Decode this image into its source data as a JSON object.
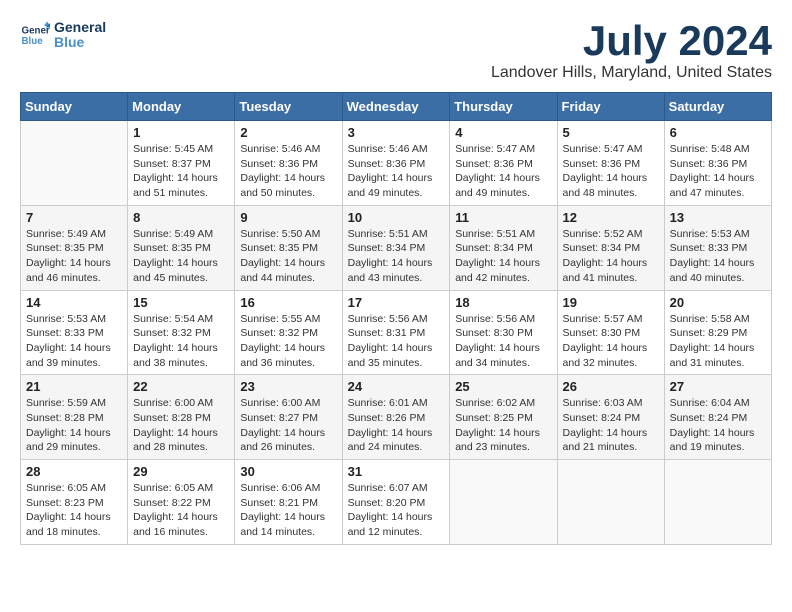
{
  "header": {
    "logo_line1": "General",
    "logo_line2": "Blue",
    "month": "July 2024",
    "location": "Landover Hills, Maryland, United States"
  },
  "weekdays": [
    "Sunday",
    "Monday",
    "Tuesday",
    "Wednesday",
    "Thursday",
    "Friday",
    "Saturday"
  ],
  "weeks": [
    [
      {
        "day": "",
        "info": ""
      },
      {
        "day": "1",
        "info": "Sunrise: 5:45 AM\nSunset: 8:37 PM\nDaylight: 14 hours\nand 51 minutes."
      },
      {
        "day": "2",
        "info": "Sunrise: 5:46 AM\nSunset: 8:36 PM\nDaylight: 14 hours\nand 50 minutes."
      },
      {
        "day": "3",
        "info": "Sunrise: 5:46 AM\nSunset: 8:36 PM\nDaylight: 14 hours\nand 49 minutes."
      },
      {
        "day": "4",
        "info": "Sunrise: 5:47 AM\nSunset: 8:36 PM\nDaylight: 14 hours\nand 49 minutes."
      },
      {
        "day": "5",
        "info": "Sunrise: 5:47 AM\nSunset: 8:36 PM\nDaylight: 14 hours\nand 48 minutes."
      },
      {
        "day": "6",
        "info": "Sunrise: 5:48 AM\nSunset: 8:36 PM\nDaylight: 14 hours\nand 47 minutes."
      }
    ],
    [
      {
        "day": "7",
        "info": "Sunrise: 5:49 AM\nSunset: 8:35 PM\nDaylight: 14 hours\nand 46 minutes."
      },
      {
        "day": "8",
        "info": "Sunrise: 5:49 AM\nSunset: 8:35 PM\nDaylight: 14 hours\nand 45 minutes."
      },
      {
        "day": "9",
        "info": "Sunrise: 5:50 AM\nSunset: 8:35 PM\nDaylight: 14 hours\nand 44 minutes."
      },
      {
        "day": "10",
        "info": "Sunrise: 5:51 AM\nSunset: 8:34 PM\nDaylight: 14 hours\nand 43 minutes."
      },
      {
        "day": "11",
        "info": "Sunrise: 5:51 AM\nSunset: 8:34 PM\nDaylight: 14 hours\nand 42 minutes."
      },
      {
        "day": "12",
        "info": "Sunrise: 5:52 AM\nSunset: 8:34 PM\nDaylight: 14 hours\nand 41 minutes."
      },
      {
        "day": "13",
        "info": "Sunrise: 5:53 AM\nSunset: 8:33 PM\nDaylight: 14 hours\nand 40 minutes."
      }
    ],
    [
      {
        "day": "14",
        "info": "Sunrise: 5:53 AM\nSunset: 8:33 PM\nDaylight: 14 hours\nand 39 minutes."
      },
      {
        "day": "15",
        "info": "Sunrise: 5:54 AM\nSunset: 8:32 PM\nDaylight: 14 hours\nand 38 minutes."
      },
      {
        "day": "16",
        "info": "Sunrise: 5:55 AM\nSunset: 8:32 PM\nDaylight: 14 hours\nand 36 minutes."
      },
      {
        "day": "17",
        "info": "Sunrise: 5:56 AM\nSunset: 8:31 PM\nDaylight: 14 hours\nand 35 minutes."
      },
      {
        "day": "18",
        "info": "Sunrise: 5:56 AM\nSunset: 8:30 PM\nDaylight: 14 hours\nand 34 minutes."
      },
      {
        "day": "19",
        "info": "Sunrise: 5:57 AM\nSunset: 8:30 PM\nDaylight: 14 hours\nand 32 minutes."
      },
      {
        "day": "20",
        "info": "Sunrise: 5:58 AM\nSunset: 8:29 PM\nDaylight: 14 hours\nand 31 minutes."
      }
    ],
    [
      {
        "day": "21",
        "info": "Sunrise: 5:59 AM\nSunset: 8:28 PM\nDaylight: 14 hours\nand 29 minutes."
      },
      {
        "day": "22",
        "info": "Sunrise: 6:00 AM\nSunset: 8:28 PM\nDaylight: 14 hours\nand 28 minutes."
      },
      {
        "day": "23",
        "info": "Sunrise: 6:00 AM\nSunset: 8:27 PM\nDaylight: 14 hours\nand 26 minutes."
      },
      {
        "day": "24",
        "info": "Sunrise: 6:01 AM\nSunset: 8:26 PM\nDaylight: 14 hours\nand 24 minutes."
      },
      {
        "day": "25",
        "info": "Sunrise: 6:02 AM\nSunset: 8:25 PM\nDaylight: 14 hours\nand 23 minutes."
      },
      {
        "day": "26",
        "info": "Sunrise: 6:03 AM\nSunset: 8:24 PM\nDaylight: 14 hours\nand 21 minutes."
      },
      {
        "day": "27",
        "info": "Sunrise: 6:04 AM\nSunset: 8:24 PM\nDaylight: 14 hours\nand 19 minutes."
      }
    ],
    [
      {
        "day": "28",
        "info": "Sunrise: 6:05 AM\nSunset: 8:23 PM\nDaylight: 14 hours\nand 18 minutes."
      },
      {
        "day": "29",
        "info": "Sunrise: 6:05 AM\nSunset: 8:22 PM\nDaylight: 14 hours\nand 16 minutes."
      },
      {
        "day": "30",
        "info": "Sunrise: 6:06 AM\nSunset: 8:21 PM\nDaylight: 14 hours\nand 14 minutes."
      },
      {
        "day": "31",
        "info": "Sunrise: 6:07 AM\nSunset: 8:20 PM\nDaylight: 14 hours\nand 12 minutes."
      },
      {
        "day": "",
        "info": ""
      },
      {
        "day": "",
        "info": ""
      },
      {
        "day": "",
        "info": ""
      }
    ]
  ]
}
